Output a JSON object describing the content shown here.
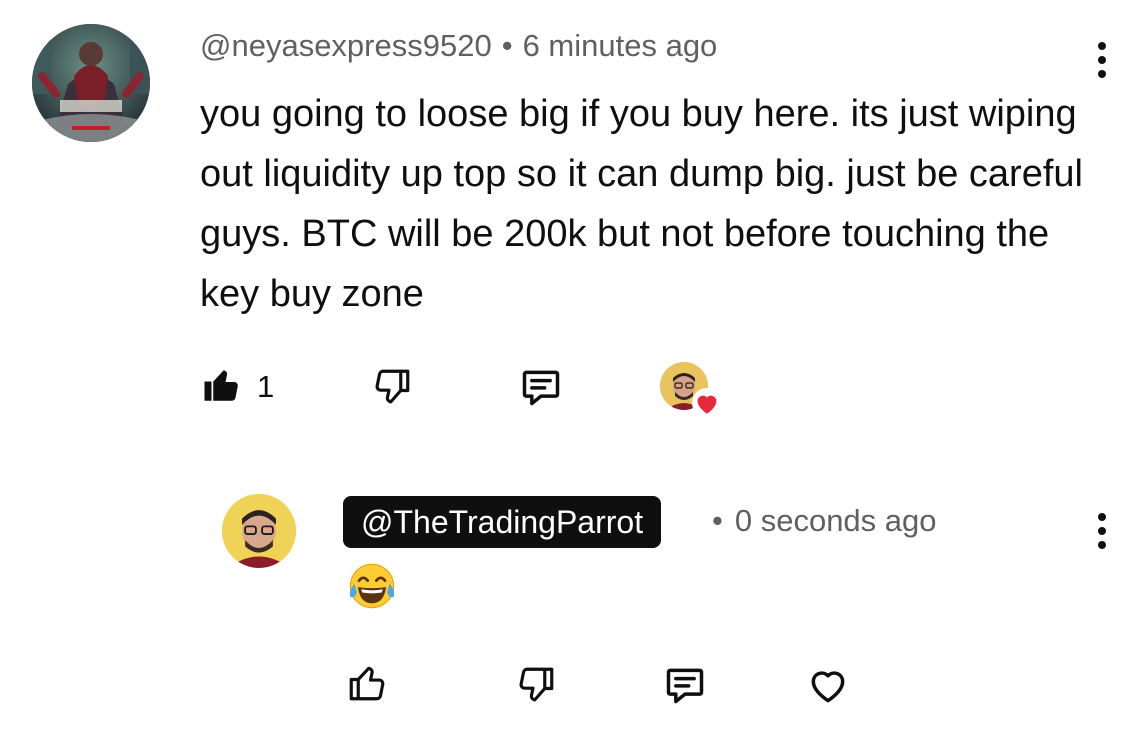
{
  "comment": {
    "author": "@neyasexpress9520",
    "separator": "•",
    "time": "6 minutes ago",
    "text": "you going to loose big if you buy here. its just wiping out liquidity up top so it can dump big. just be careful guys. BTC will be 200k but not before touching the key buy zone",
    "like_count": "1",
    "liked": true,
    "hearted_by_creator": true
  },
  "reply": {
    "author": "@TheTradingParrot",
    "separator": "•",
    "time": "0 seconds ago",
    "emoji_name": "face-with-tears-of-joy",
    "liked": false
  },
  "icons": {
    "like": "thumbs-up-icon",
    "dislike": "thumbs-down-icon",
    "reply": "reply-icon",
    "more": "more-vertical-icon",
    "heart": "heart-icon"
  },
  "colors": {
    "text": "#0f0f0f",
    "meta": "#606060",
    "heart": "#e8293b",
    "creator_pill_bg": "#0f0f0f"
  }
}
